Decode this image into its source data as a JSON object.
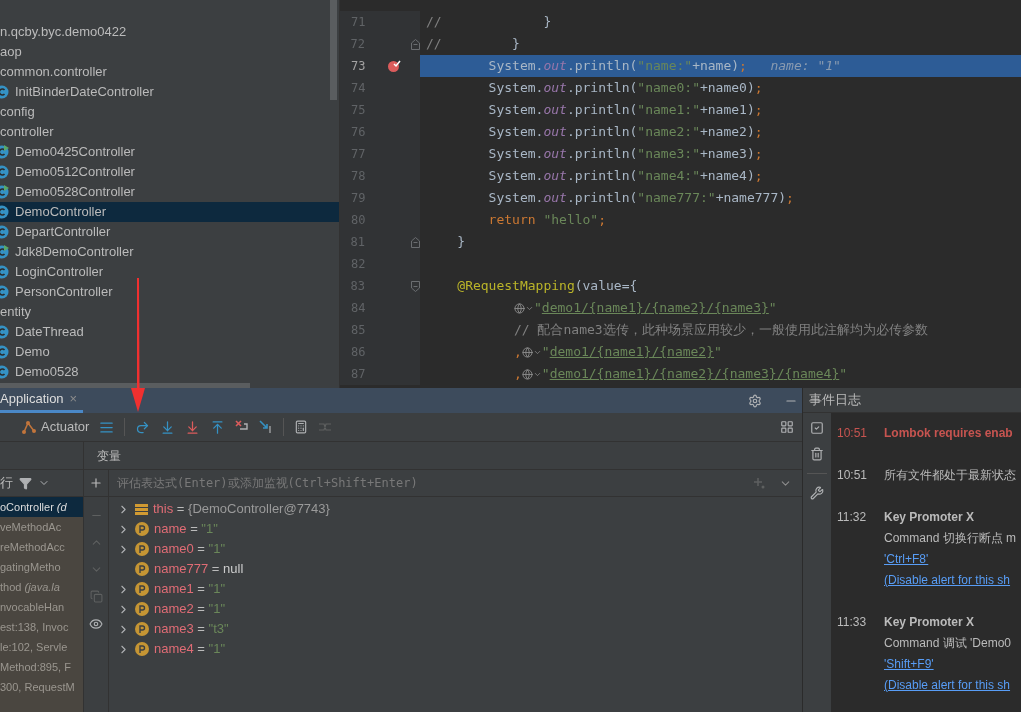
{
  "project_tree": {
    "items": [
      {
        "label": "n.qcby.byc.demo0422",
        "kind": "package",
        "selected": false
      },
      {
        "label": "aop",
        "kind": "package",
        "selected": false
      },
      {
        "label": "common.controller",
        "kind": "package",
        "selected": false
      },
      {
        "label": "InitBinderDateController",
        "kind": "class",
        "selected": false
      },
      {
        "label": "config",
        "kind": "package",
        "selected": false
      },
      {
        "label": "controller",
        "kind": "package",
        "selected": false
      },
      {
        "label": "Demo0425Controller",
        "kind": "runnable-class",
        "selected": false
      },
      {
        "label": "Demo0512Controller",
        "kind": "class",
        "selected": false
      },
      {
        "label": "Demo0528Controller",
        "kind": "runnable-class",
        "selected": false
      },
      {
        "label": "DemoController",
        "kind": "class",
        "selected": true
      },
      {
        "label": "DepartController",
        "kind": "class",
        "selected": false
      },
      {
        "label": "Jdk8DemoController",
        "kind": "runnable-class",
        "selected": false
      },
      {
        "label": "LoginController",
        "kind": "class",
        "selected": false
      },
      {
        "label": "PersonController",
        "kind": "class",
        "selected": false
      },
      {
        "label": "entity",
        "kind": "package",
        "selected": false
      },
      {
        "label": "DateThread",
        "kind": "class",
        "selected": false
      },
      {
        "label": "Demo",
        "kind": "class",
        "selected": false
      },
      {
        "label": "Demo0528",
        "kind": "class",
        "selected": false
      }
    ]
  },
  "editor": {
    "lines": [
      {
        "number": "71",
        "kind": "code",
        "tokens": [
          {
            "text": "//",
            "kind": "comment"
          },
          {
            "text": "             }",
            "kind": "plain"
          }
        ]
      },
      {
        "number": "72",
        "kind": "fold-end",
        "tokens": [
          {
            "text": "//",
            "kind": "comment"
          },
          {
            "text": "         }",
            "kind": "plain"
          }
        ]
      },
      {
        "number": "73",
        "kind": "code",
        "current": true,
        "breakpoint": true,
        "tokens": [
          {
            "text": "        System.",
            "kind": "plain"
          },
          {
            "text": "out",
            "kind": "field"
          },
          {
            "text": ".println(",
            "kind": "plain"
          },
          {
            "text": "\"name:\"",
            "kind": "string"
          },
          {
            "text": "+name)",
            "kind": "plain"
          },
          {
            "text": ";",
            "kind": "punct"
          },
          {
            "text": "   name: \"1\"",
            "kind": "hint"
          }
        ]
      },
      {
        "number": "74",
        "kind": "code",
        "tokens": [
          {
            "text": "        System.",
            "kind": "plain"
          },
          {
            "text": "out",
            "kind": "field"
          },
          {
            "text": ".println(",
            "kind": "plain"
          },
          {
            "text": "\"name0:\"",
            "kind": "string"
          },
          {
            "text": "+name0)",
            "kind": "plain"
          },
          {
            "text": ";",
            "kind": "punct"
          }
        ]
      },
      {
        "number": "75",
        "kind": "code",
        "tokens": [
          {
            "text": "        System.",
            "kind": "plain"
          },
          {
            "text": "out",
            "kind": "field"
          },
          {
            "text": ".println(",
            "kind": "plain"
          },
          {
            "text": "\"name1:\"",
            "kind": "string"
          },
          {
            "text": "+name1)",
            "kind": "plain"
          },
          {
            "text": ";",
            "kind": "punct"
          }
        ]
      },
      {
        "number": "76",
        "kind": "code",
        "tokens": [
          {
            "text": "        System.",
            "kind": "plain"
          },
          {
            "text": "out",
            "kind": "field"
          },
          {
            "text": ".println(",
            "kind": "plain"
          },
          {
            "text": "\"name2:\"",
            "kind": "string"
          },
          {
            "text": "+name2)",
            "kind": "plain"
          },
          {
            "text": ";",
            "kind": "punct"
          }
        ]
      },
      {
        "number": "77",
        "kind": "code",
        "tokens": [
          {
            "text": "        System.",
            "kind": "plain"
          },
          {
            "text": "out",
            "kind": "field"
          },
          {
            "text": ".println(",
            "kind": "plain"
          },
          {
            "text": "\"name3:\"",
            "kind": "string"
          },
          {
            "text": "+name3)",
            "kind": "plain"
          },
          {
            "text": ";",
            "kind": "punct"
          }
        ]
      },
      {
        "number": "78",
        "kind": "code",
        "tokens": [
          {
            "text": "        System.",
            "kind": "plain"
          },
          {
            "text": "out",
            "kind": "field"
          },
          {
            "text": ".println(",
            "kind": "plain"
          },
          {
            "text": "\"name4:\"",
            "kind": "string"
          },
          {
            "text": "+name4)",
            "kind": "plain"
          },
          {
            "text": ";",
            "kind": "punct"
          }
        ]
      },
      {
        "number": "79",
        "kind": "code",
        "tokens": [
          {
            "text": "        System.",
            "kind": "plain"
          },
          {
            "text": "out",
            "kind": "field"
          },
          {
            "text": ".println(",
            "kind": "plain"
          },
          {
            "text": "\"name777:\"",
            "kind": "string"
          },
          {
            "text": "+name777)",
            "kind": "plain"
          },
          {
            "text": ";",
            "kind": "punct"
          }
        ]
      },
      {
        "number": "80",
        "kind": "code",
        "tokens": [
          {
            "text": "        return",
            "kind": "keyword"
          },
          {
            "text": " \"hello\"",
            "kind": "string"
          },
          {
            "text": ";",
            "kind": "punct"
          }
        ]
      },
      {
        "number": "81",
        "kind": "fold-end",
        "tokens": [
          {
            "text": "    }",
            "kind": "plain"
          }
        ]
      },
      {
        "number": "82",
        "kind": "code"
      },
      {
        "number": "83",
        "kind": "fold-start",
        "tokens": [
          {
            "text": "    @RequestMapping",
            "kind": "annotation"
          },
          {
            "text": "(value={",
            "kind": "plain"
          }
        ]
      },
      {
        "number": "84",
        "kind": "continuation",
        "tokens": [
          {
            "kind": "globe"
          },
          {
            "text": "\"",
            "kind": "string"
          },
          {
            "text": "demo1/{name1}/{name2}/{name3}",
            "kind": "link"
          },
          {
            "text": "\"",
            "kind": "string"
          }
        ]
      },
      {
        "number": "85",
        "kind": "continuation",
        "tokens": [
          {
            "text": "// 配合name3选传，此种场景应用较少，一般使用此注解均为必传参数",
            "kind": "comment"
          }
        ]
      },
      {
        "number": "86",
        "kind": "continuation",
        "tokens": [
          {
            "text": ",",
            "kind": "punct"
          },
          {
            "kind": "globe"
          },
          {
            "text": "\"",
            "kind": "string"
          },
          {
            "text": "demo1/{name1}/{name2}",
            "kind": "link"
          },
          {
            "text": "\"",
            "kind": "string"
          }
        ]
      },
      {
        "number": "87",
        "kind": "continuation",
        "tokens": [
          {
            "text": ",",
            "kind": "punct"
          },
          {
            "kind": "globe"
          },
          {
            "text": "\"",
            "kind": "string"
          },
          {
            "text": "demo1/{name1}/{name2}/{name3}/{name4}",
            "kind": "link"
          },
          {
            "text": "\"",
            "kind": "string"
          }
        ]
      }
    ]
  },
  "debug": {
    "tab": {
      "label": "Application",
      "close": "×"
    },
    "toolbar_label": "Actuator",
    "variables_title": "变量",
    "frames_filter_label": "行",
    "eval_placeholder": "评估表达式(Enter)或添加监视(Ctrl+Shift+Enter)",
    "frames": [
      {
        "label": "oController *(d*",
        "selected": true
      },
      {
        "label": "veMethodAc",
        "selected": false
      },
      {
        "label": "reMethodAcc",
        "selected": false
      },
      {
        "label": "gatingMetho",
        "selected": false
      },
      {
        "label": "thod *(java.la*",
        "selected": false
      },
      {
        "label": "nvocableHan",
        "selected": false
      },
      {
        "label": "est:138, Invoc",
        "selected": false
      },
      {
        "label": "le:102, Servle",
        "selected": false
      },
      {
        "label": "Method:895, F",
        "selected": false
      },
      {
        "label": "300, RequestM",
        "selected": false
      }
    ],
    "variables": [
      {
        "name": "this",
        "operator": "=",
        "value": {
          "text": "{DemoController@7743}",
          "kind": "object"
        },
        "kind": "object",
        "expandable": true
      },
      {
        "name": "name",
        "operator": "=",
        "value": {
          "text": "\"1\"",
          "kind": "string"
        },
        "kind": "param",
        "expandable": true
      },
      {
        "name": "name0",
        "operator": "=",
        "value": {
          "text": "\"1\"",
          "kind": "string"
        },
        "kind": "param",
        "expandable": true
      },
      {
        "name": "name777",
        "operator": "=",
        "value": {
          "text": "null",
          "kind": "null"
        },
        "kind": "param",
        "expandable": false
      },
      {
        "name": "name1",
        "operator": "=",
        "value": {
          "text": "\"1\"",
          "kind": "string"
        },
        "kind": "param",
        "expandable": true
      },
      {
        "name": "name2",
        "operator": "=",
        "value": {
          "text": "\"1\"",
          "kind": "string"
        },
        "kind": "param",
        "expandable": true
      },
      {
        "name": "name3",
        "operator": "=",
        "value": {
          "text": "\"t3\"",
          "kind": "string"
        },
        "kind": "param",
        "expandable": true
      },
      {
        "name": "name4",
        "operator": "=",
        "value": {
          "text": "\"1\"",
          "kind": "string"
        },
        "kind": "param",
        "expandable": true
      }
    ]
  },
  "event_log": {
    "title": "事件日志",
    "entries": [
      {
        "time": "10:51",
        "kind": "error",
        "title": "Lombok requires enab"
      },
      {
        "time": "10:51",
        "kind": "info",
        "lines": [
          {
            "text": "所有文件都处于最新状态",
            "kind": "text"
          }
        ]
      },
      {
        "time": "11:32",
        "kind": "info",
        "title": "Key Promoter X",
        "lines": [
          {
            "text": "Command 切换行断点 m",
            "kind": "text"
          },
          {
            "text": "'Ctrl+F8'",
            "kind": "link"
          },
          {
            "text": "(Disable alert for this sh",
            "kind": "link"
          }
        ]
      },
      {
        "time": "11:33",
        "kind": "info",
        "title": "Key Promoter X",
        "lines": [
          {
            "text": "Command 调试 'Demo0",
            "kind": "text"
          },
          {
            "text": "'Shift+F9'",
            "kind": "link"
          },
          {
            "text": "(Disable alert for this sh",
            "kind": "link"
          }
        ]
      }
    ]
  }
}
